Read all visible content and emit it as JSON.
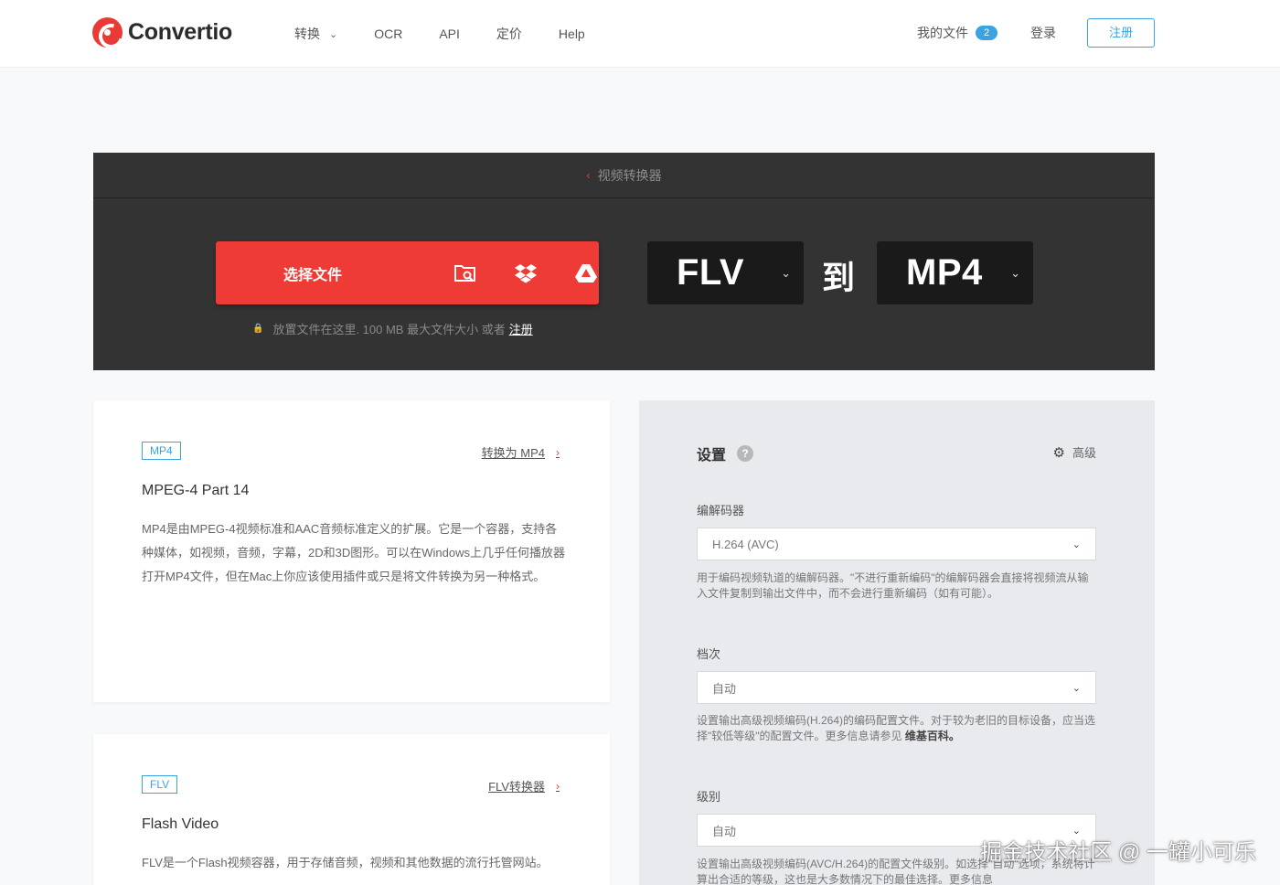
{
  "header": {
    "logo_text": "Convertio",
    "nav": [
      {
        "label": "转换",
        "has_dropdown": true
      },
      {
        "label": "OCR"
      },
      {
        "label": "API"
      },
      {
        "label": "定价"
      },
      {
        "label": "Help"
      }
    ],
    "my_files": "我的文件",
    "my_files_count": "2",
    "login": "登录",
    "register": "注册"
  },
  "hero": {
    "breadcrumb": "视频转换器",
    "choose_files": "选择文件",
    "hint_text": "放置文件在这里. 100 MB 最大文件大小 或者",
    "hint_register": "注册",
    "from_format": "FLV",
    "to_label": "到",
    "to_format": "MP4"
  },
  "cards": [
    {
      "tag": "MP4",
      "link": "转换为 MP4",
      "title": "MPEG-4 Part 14",
      "description": "MP4是由MPEG-4视频标准和AAC音频标准定义的扩展。它是一个容器，支持各种媒体，如视频，音频，字幕，2D和3D图形。可以在Windows上几乎任何播放器打开MP4文件，但在Mac上你应该使用插件或只是将文件转换为另一种格式。"
    },
    {
      "tag": "FLV",
      "link": "FLV转换器",
      "title": "Flash Video",
      "description": "FLV是一个Flash视频容器，用于存储音频，视频和其他数据的流行托管网站。"
    }
  ],
  "settings": {
    "title": "设置",
    "advanced": "高级",
    "fields": [
      {
        "label": "编解码器",
        "value": "H.264 (AVC)",
        "help": "用于编码视频轨道的编解码器。\"不进行重新编码\"的编解码器会直接将视频流从输入文件复制到输出文件中，而不会进行重新编码（如有可能）。",
        "help_bold": ""
      },
      {
        "label": "档次",
        "value": "自动",
        "help": "设置输出高级视频编码(H.264)的编码配置文件。对于较为老旧的目标设备，应当选择\"较低等级\"的配置文件。更多信息请参见",
        "help_bold": "维基百科。"
      },
      {
        "label": "级别",
        "value": "自动",
        "help": "设置输出高级视频编码(AVC/H.264)的配置文件级别。如选择\"自动\"选项，系统将计算出合适的等级，这也是大多数情况下的最佳选择。更多信息",
        "help_bold": ""
      }
    ]
  },
  "watermark": "掘金技术社区 @ 一罐小可乐",
  "colors": {
    "brand_red": "#ef3b36",
    "accent_blue": "#3aa3e3",
    "hero_bg": "#333333",
    "format_box_bg": "#1a1a1a"
  }
}
